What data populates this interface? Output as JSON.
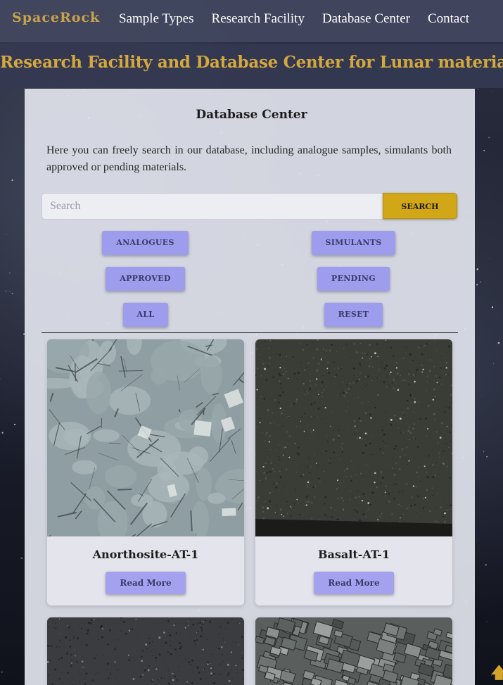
{
  "brand": "SpaceRock",
  "nav": {
    "links": [
      "Sample Types",
      "Research Facility",
      "Database Center",
      "Contact"
    ]
  },
  "hero": {
    "title": "Research Facility and Database Center for Lunar materials"
  },
  "section": {
    "title": "Database Center",
    "intro": "Here you can freely search in our database, including analogue samples, simulants both approved or pending materials."
  },
  "search": {
    "placeholder": "Search",
    "value": "",
    "button_label": "SEARCH"
  },
  "filters": {
    "analogues": "ANALOGUES",
    "simulants": "SIMULANTS",
    "approved": "APPROVED",
    "pending": "PENDING",
    "all": "ALL",
    "reset": "RESET"
  },
  "cards": [
    {
      "title": "Anorthosite-AT-1",
      "button": "Read More"
    },
    {
      "title": "Basalt-AT-1",
      "button": "Read More"
    },
    {
      "title": "",
      "button": ""
    },
    {
      "title": "",
      "button": ""
    }
  ],
  "icons": {
    "scroll_top": "arrow-up-icon"
  },
  "colors": {
    "brand": "#c9a34b",
    "hero_title": "#d4a83e",
    "search_button": "#d1a617",
    "filter_button": "#9e9ced",
    "read_more": "#a4a2ef"
  }
}
